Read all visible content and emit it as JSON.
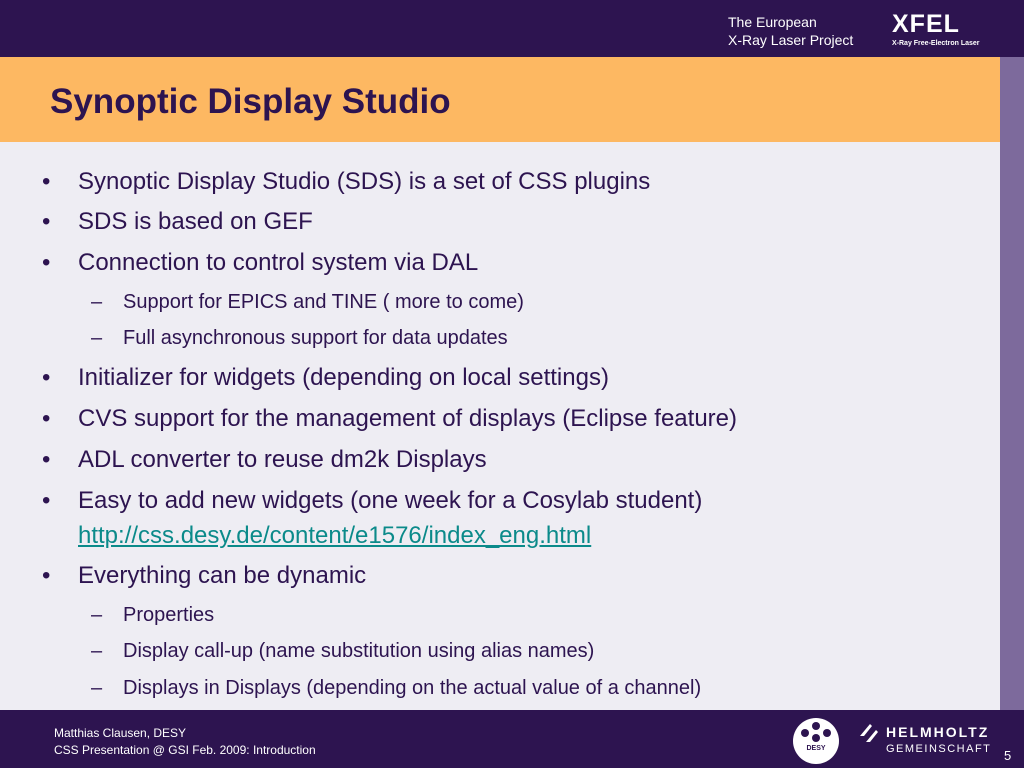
{
  "header": {
    "brand_line1": "The European",
    "brand_line2": "X-Ray Laser Project",
    "logo_word": "XFEL",
    "logo_subtitle": "X-Ray Free-Electron Laser"
  },
  "slide": {
    "title": "Synoptic Display Studio",
    "bullets": [
      "Synoptic Display Studio (SDS) is a set of CSS plugins",
      "SDS is based on GEF",
      "Connection to control system via DAL",
      "Support for EPICS and TINE ( more to come)",
      "Full asynchronous support for data updates",
      "Initializer for widgets  (depending on local settings)",
      "CVS support for the management of displays (Eclipse feature)",
      "ADL converter to reuse dm2k Displays",
      "Easy to add new widgets (one week for a Cosylab student)",
      "Everything can be dynamic",
      "Properties",
      "Display call-up (name substitution using alias names)",
      "Displays in Displays (depending on the actual value of a channel)"
    ],
    "link": "http://css.desy.de/content/e1576/index_eng.html",
    "bullet_mark": "•",
    "sub_mark": "–"
  },
  "footer": {
    "line1": "Matthias Clausen, DESY",
    "line2": "CSS Presentation @ GSI Feb. 2009: Introduction",
    "desy_label": "DESY",
    "helmholtz_word": "HELMHOLTZ",
    "helmholtz_sub": "GEMEINSCHAFT",
    "page_number": "5"
  },
  "colors": {
    "navy": "#2d1450",
    "orange": "#fdb862",
    "content_bg": "#eeedf3",
    "strip": "#7d6a9c",
    "link": "#0b8a8a"
  }
}
